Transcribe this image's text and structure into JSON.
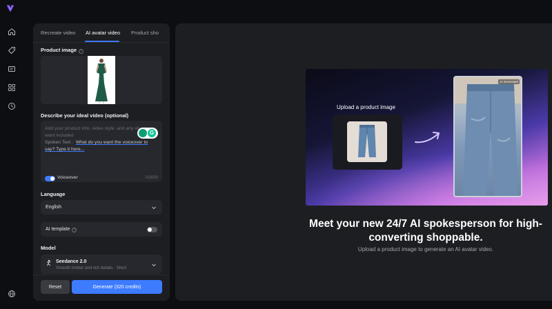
{
  "colors": {
    "accent": "#3d7bff",
    "panel": "#1d1e22",
    "field": "#27282d"
  },
  "rail": {
    "icons": [
      "home-icon",
      "tag-icon",
      "video-badge-icon",
      "apps-grid-icon",
      "history-clock-icon",
      "globe-icon"
    ]
  },
  "tabs": [
    {
      "label": "Recreate video",
      "active": false
    },
    {
      "label": "AI avatar video",
      "active": true
    },
    {
      "label": "Product sho",
      "active": false
    }
  ],
  "product_image": {
    "label": "Product image"
  },
  "describe": {
    "label": "Describe your ideal video (optional)",
    "placeholder": "Add your product info, video style, and any ideas you want included",
    "spoken_prefix": "Spoken Text :",
    "spoken_link": "What do you want the voiceover to say? Type it here...",
    "voiceover_label": "Voiceover",
    "voiceover_on": true,
    "counter": "0/3000"
  },
  "language": {
    "label": "Language",
    "value": "English"
  },
  "ai_template": {
    "label": "AI template",
    "on": false
  },
  "model": {
    "label": "Model",
    "name": "Seedance 2.0",
    "description": "Smooth motion and rich details · Short"
  },
  "footer": {
    "reset_label": "Reset",
    "generate_label": "Generate (320 credits)"
  },
  "preview": {
    "upload_label": "Upload a product image",
    "ai_tag": "AI Generated",
    "headline": "Meet your new 24/7 AI spokesperson for high-converting shoppable.",
    "subline": "Upload a product image to generate an AI avatar video."
  }
}
